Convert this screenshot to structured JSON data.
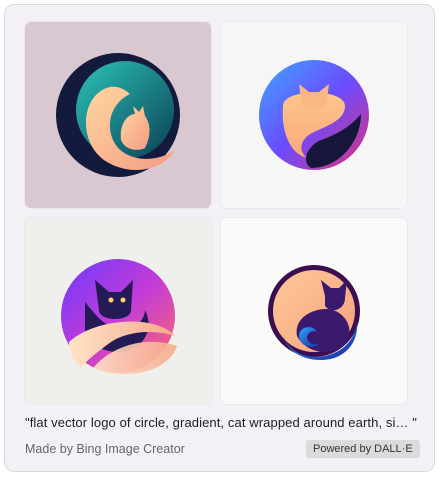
{
  "caption": "\"flat vector logo of circle, gradient, cat wrapped around earth, si…  \"",
  "credit": "Made by Bing Image Creator",
  "badge": "Powered by DALL·E",
  "images": [
    {
      "name": "cat-logo-image-1",
      "background": "#d9c8d2"
    },
    {
      "name": "cat-logo-image-2",
      "background": "#f7f6f7"
    },
    {
      "name": "cat-logo-image-3",
      "background": "#eff0ec"
    },
    {
      "name": "cat-logo-image-4",
      "background": "#fbfafb"
    }
  ]
}
